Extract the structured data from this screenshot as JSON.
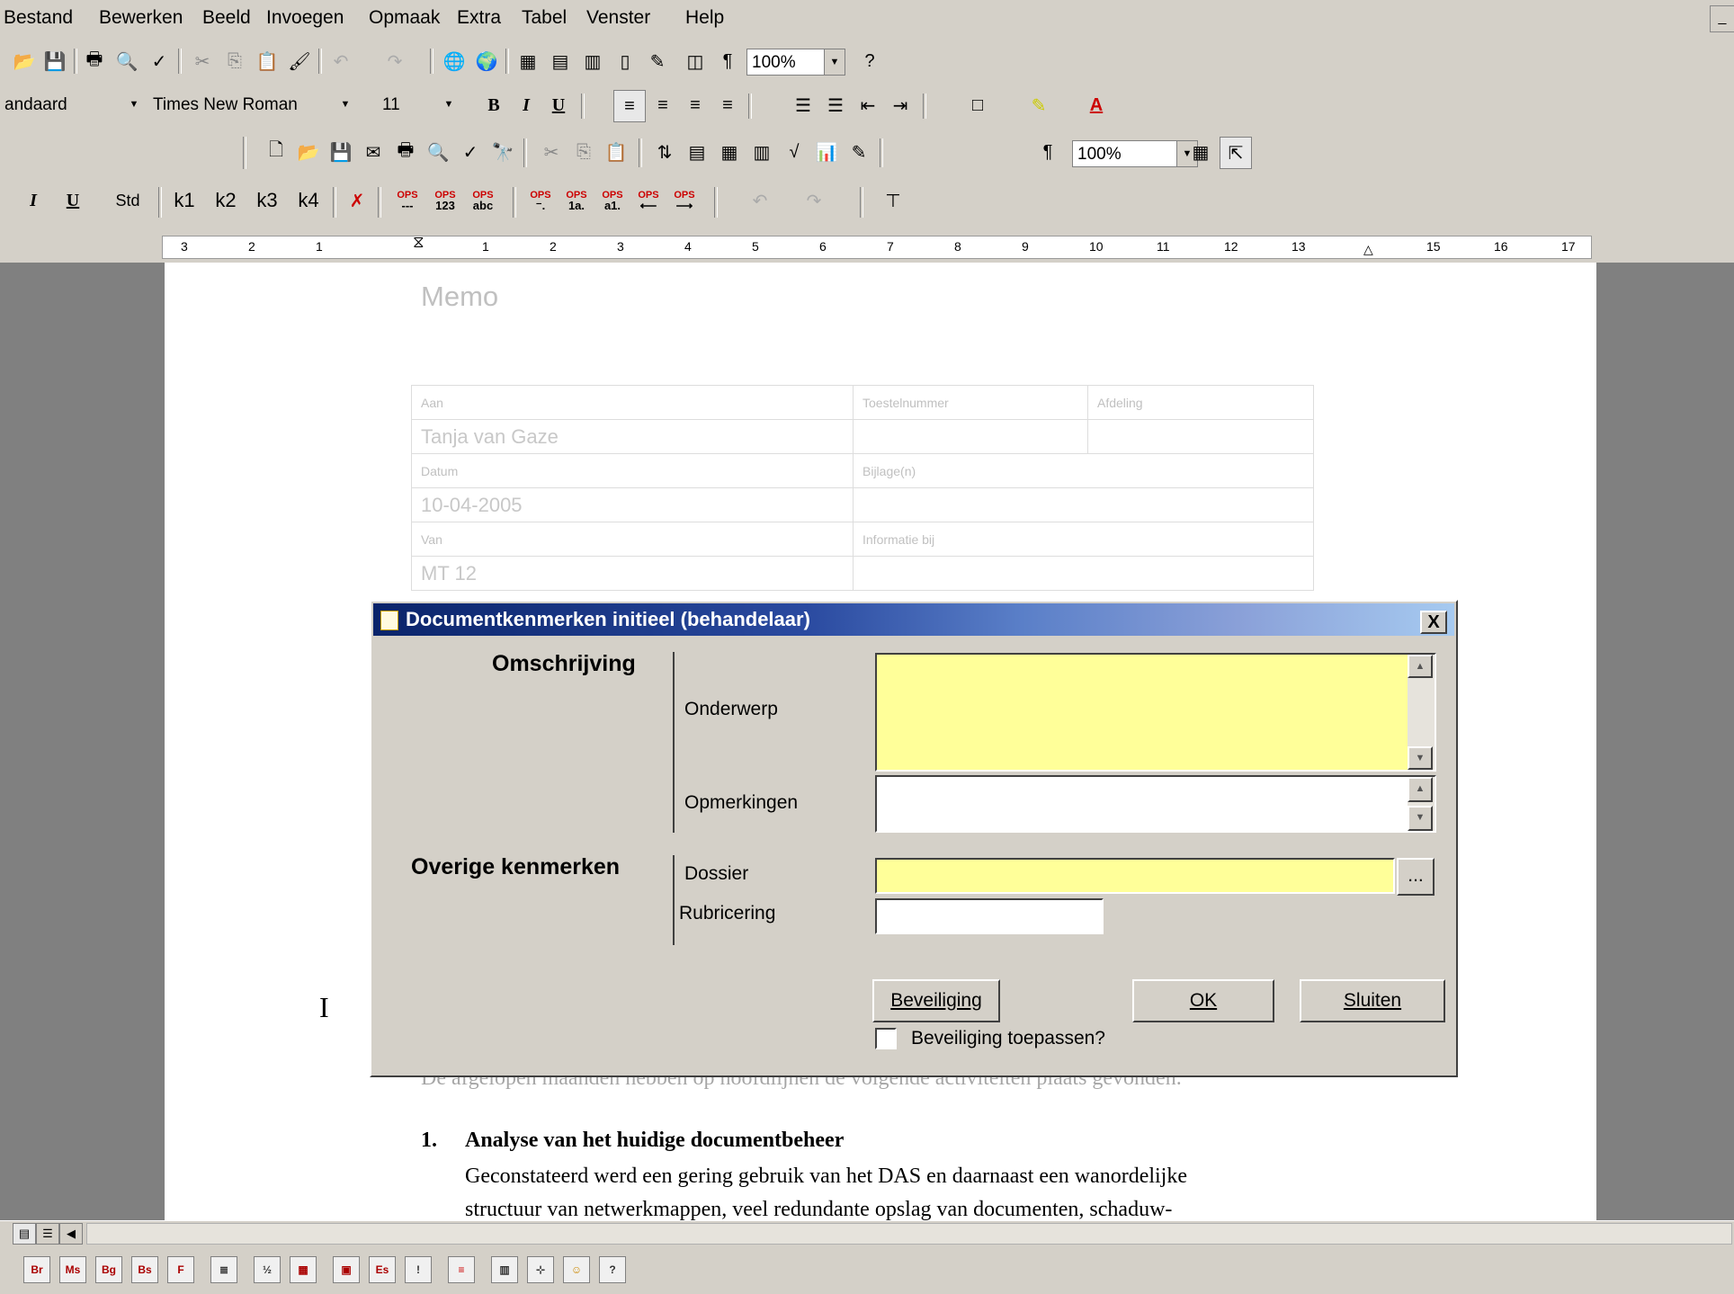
{
  "menu": {
    "items": [
      "Bestand",
      "Bewerken",
      "Beeld",
      "Invoegen",
      "Opmaak",
      "Extra",
      "Tabel",
      "Venster",
      "Help"
    ],
    "minimize": "_"
  },
  "toolbar1": {
    "zoom": "100%"
  },
  "toolbar2": {
    "style": "andaard",
    "font": "Times New Roman",
    "size": "11",
    "bold": "B",
    "italic": "I",
    "underline": "U"
  },
  "toolbar3": {
    "zoom": "100%",
    "pilcrow": "¶"
  },
  "toolbar4": {
    "italic": "I",
    "underline": "U",
    "std": "Std",
    "k1": "k1",
    "k2": "k2",
    "k3": "k3",
    "k4": "k4",
    "ops1": "OPS",
    "ops_dash": "---",
    "ops_123": "123",
    "ops_abc": "abc",
    "ops_1a": "1a.",
    "ops_a1": "a1."
  },
  "ruler": {
    "labels": [
      "3",
      "2",
      "1",
      "1",
      "2",
      "3",
      "4",
      "5",
      "6",
      "7",
      "8",
      "9",
      "10",
      "11",
      "12",
      "13",
      "15",
      "16",
      "17"
    ]
  },
  "document": {
    "memo_title": "Memo",
    "header_rows": [
      [
        "Aan",
        "Toestelnummer",
        "Afdeling"
      ],
      [
        "Tanja van Gaze",
        "",
        ""
      ],
      [
        "Datum",
        "Bijlage(n)",
        ""
      ],
      [
        "10-04-2005",
        "",
        ""
      ],
      [
        "Van",
        "Informatie bij",
        ""
      ],
      [
        "MT 12",
        "",
        ""
      ]
    ],
    "ibeam": "I",
    "line_partial": "De afgelopen maanden hebben op hoofdlijnen de volgende activiteiten plaats gevonden.",
    "item_num": "1.",
    "item_heading": "Analyse van het huidige documentbeheer",
    "item_line1": "Geconstateerd werd een gering gebruik van het DAS en daarnaast een wanordelijke",
    "item_line2": "structuur van netwerkmappen, veel redundante opslag van documenten, schaduw-"
  },
  "dialog": {
    "title": "Documentkenmerken initieel (behandelaar)",
    "close": "X",
    "section_omschrijving": "Omschrijving",
    "section_overige": "Overige kenmerken",
    "label_onderwerp": "Onderwerp",
    "label_opmerkingen": "Opmerkingen",
    "label_dossier": "Dossier",
    "label_rubricering": "Rubricering",
    "onderwerp_value": "",
    "opmerkingen_value": "",
    "dossier_value": "",
    "rubricering_value": "",
    "dossier_browse": "...",
    "btn_beveiliging": "Beveiliging",
    "btn_ok": "OK",
    "btn_sluiten": "Sluiten",
    "chk_label": "Beveiliging toepassen?",
    "chk_checked": false
  },
  "colors": {
    "dialog_yellow": "#ffff99",
    "title_start": "#0a246a",
    "title_end": "#a6caf0",
    "window_bg": "#d4d0c8"
  }
}
